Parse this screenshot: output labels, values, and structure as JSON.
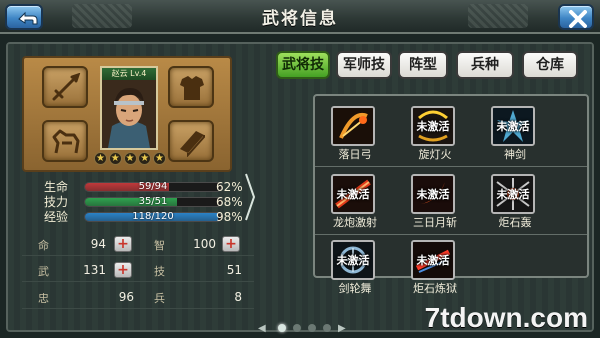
{
  "header": {
    "title": "武将信息"
  },
  "hero": {
    "name_level": "赵云 Lv.4",
    "stars": [
      "★",
      "★",
      "★",
      "★",
      "★"
    ],
    "slots": [
      "spear-icon",
      "armor-icon",
      "horse-icon",
      "book-icon"
    ]
  },
  "stats": [
    {
      "label": "生命",
      "value": "59/94",
      "percent": "62%",
      "fill": 0.62,
      "color": "#c0393b"
    },
    {
      "label": "技力",
      "value": "35/51",
      "percent": "68%",
      "fill": 0.68,
      "color": "#2fa24f"
    },
    {
      "label": "经验",
      "value": "118/120",
      "percent": "98%",
      "fill": 0.98,
      "color": "#2b83c7"
    }
  ],
  "attributes": [
    {
      "label": "命",
      "value": "94",
      "plus": "+"
    },
    {
      "label": "智",
      "value": "100",
      "plus": "+"
    },
    {
      "label": "武",
      "value": "131",
      "plus": "+"
    },
    {
      "label": "技",
      "value": "51"
    },
    {
      "label": "忠",
      "value": "96"
    },
    {
      "label": "兵",
      "value": "8"
    }
  ],
  "tabs": [
    "武将技",
    "军师技",
    "阵型",
    "兵种",
    "仓库"
  ],
  "skills": [
    {
      "name": "落日弓",
      "locked": ""
    },
    {
      "name": "旋灯火",
      "locked": "未激活"
    },
    {
      "name": "神剑",
      "locked": "未激活"
    },
    {
      "name": "龙炮激射",
      "locked": "未激活"
    },
    {
      "name": "三日月斩",
      "locked": "未激活"
    },
    {
      "name": "炬石轰",
      "locked": "未激活"
    },
    {
      "name": "剑轮舞",
      "locked": "未激活"
    },
    {
      "name": "炬石炼狱",
      "locked": "未激活"
    }
  ],
  "pager": {
    "prev": "◀",
    "next": "▶",
    "pages": 4,
    "current": 1
  },
  "watermark": "7tdown.com"
}
